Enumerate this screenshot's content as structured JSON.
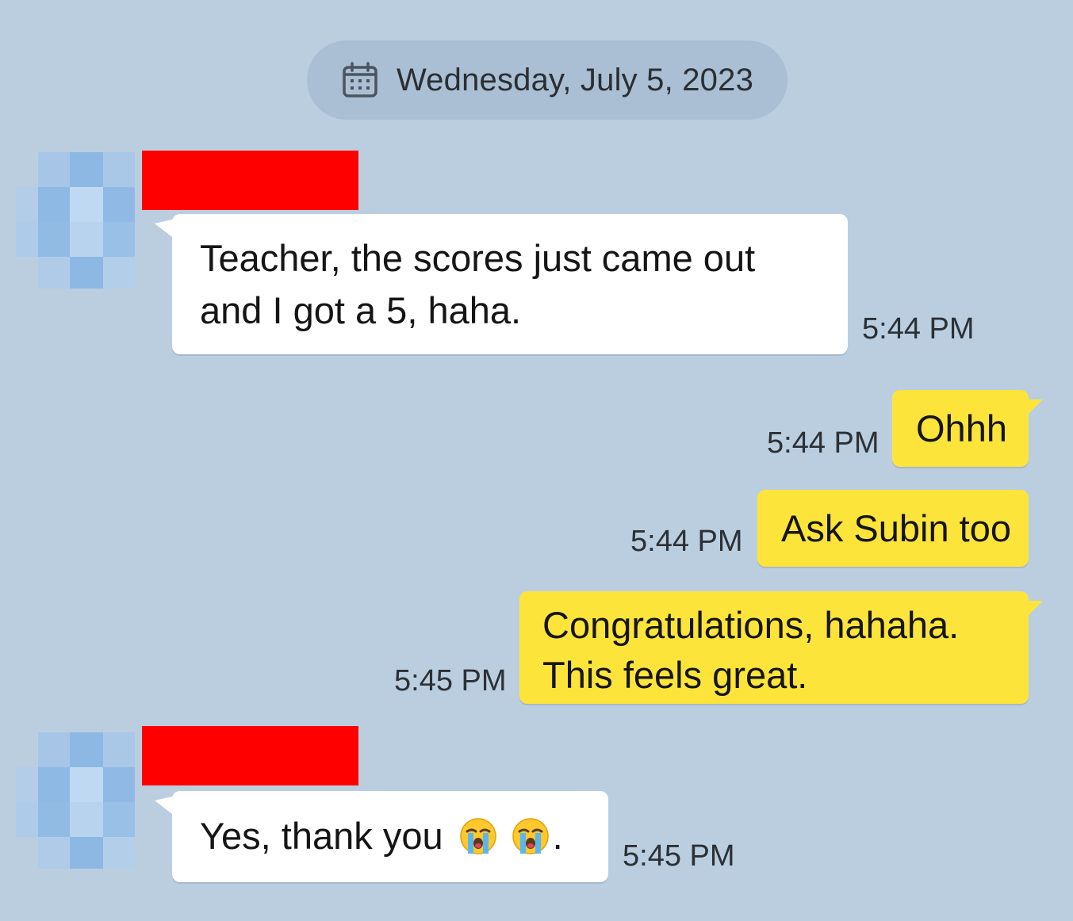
{
  "date_divider": {
    "label": "Wednesday, July 5, 2023",
    "icon": "calendar-icon"
  },
  "colors": {
    "background": "#bacee0",
    "incoming_bubble": "#ffffff",
    "outgoing_bubble": "#fde43a",
    "redaction": "#ff0000"
  },
  "messages": [
    {
      "direction": "incoming",
      "text": "Teacher, the scores just came out and I got a 5, haha.",
      "time": "5:44 PM",
      "sender_redacted": true
    },
    {
      "direction": "outgoing",
      "text": "Ohhh",
      "time": "5:44 PM"
    },
    {
      "direction": "outgoing",
      "text": "Ask Subin too",
      "time": "5:44 PM"
    },
    {
      "direction": "outgoing",
      "text": "Congratulations, hahaha. This feels great.",
      "time": "5:45 PM"
    },
    {
      "direction": "incoming",
      "text": "Yes, thank you",
      "emoji": "loudly-crying-face",
      "emoji_count": 2,
      "trailing": ".",
      "time": "5:45 PM",
      "sender_redacted": true
    }
  ]
}
